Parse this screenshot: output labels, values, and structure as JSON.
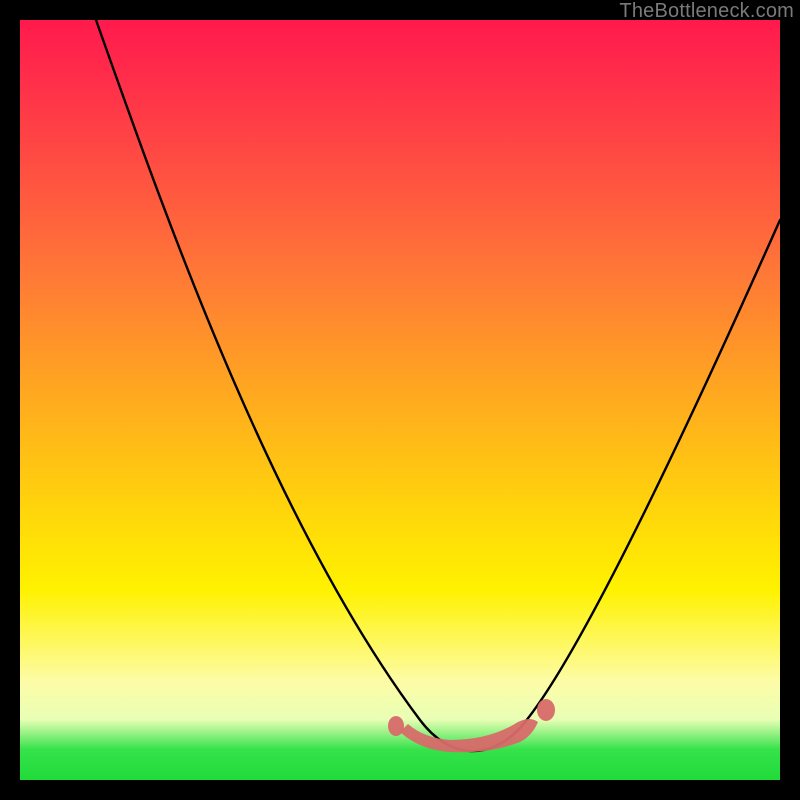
{
  "watermark": "TheBottleneck.com",
  "chart_data": {
    "type": "line",
    "title": "",
    "xlabel": "",
    "ylabel": "",
    "xlim": [
      0,
      100
    ],
    "ylim": [
      0,
      100
    ],
    "grid": false,
    "legend": false,
    "series": [
      {
        "name": "bottleneck-curve",
        "x": [
          10,
          15,
          20,
          25,
          30,
          35,
          40,
          45,
          50,
          52,
          55,
          58,
          60,
          62,
          64,
          66,
          70,
          75,
          80,
          85,
          90,
          95,
          100
        ],
        "y": [
          100,
          91,
          82,
          73,
          64,
          55,
          46,
          37,
          28,
          20,
          12,
          6,
          4,
          3,
          3,
          4,
          6,
          12,
          22,
          34,
          47,
          60,
          74
        ]
      },
      {
        "name": "bottom-highlight",
        "x": [
          52,
          55,
          58,
          60,
          62,
          64,
          66,
          68
        ],
        "y": [
          5,
          4,
          3.5,
          3,
          3,
          3.5,
          4,
          5.5
        ]
      }
    ],
    "colors": {
      "curve": "#000000",
      "highlight": "#d86a6a",
      "gradient_top": "#ff1a4d",
      "gradient_mid": "#ffce0e",
      "gradient_bottom": "#21db3a"
    }
  }
}
